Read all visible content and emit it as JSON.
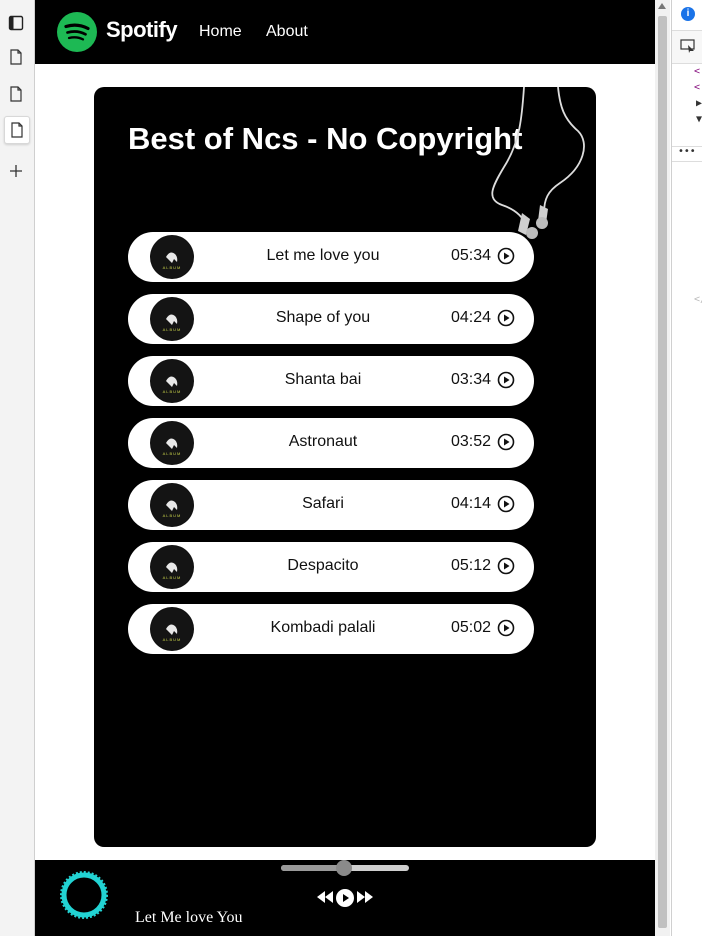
{
  "navbar": {
    "brand": "Spotify",
    "links": [
      "Home",
      "About"
    ]
  },
  "playlist": {
    "title": "Best of Ncs - No Copyright",
    "songs": [
      {
        "name": "Let me love you",
        "duration": "05:34"
      },
      {
        "name": "Shape of you",
        "duration": "04:24"
      },
      {
        "name": "Shanta bai",
        "duration": "03:34"
      },
      {
        "name": "Astronaut",
        "duration": "03:52"
      },
      {
        "name": "Safari",
        "duration": "04:14"
      },
      {
        "name": "Despacito",
        "duration": "05:12"
      },
      {
        "name": "Kombadi palali",
        "duration": "05:02"
      }
    ]
  },
  "player": {
    "now_playing": "Let Me love You",
    "progress": 0.49,
    "controls": [
      "previous-icon",
      "play-icon",
      "next-icon"
    ]
  },
  "colors": {
    "brand_green": "#1DB954",
    "background": "#000000",
    "visualizer_cyan": "#22d3d3"
  },
  "devtools": {
    "info_icon": "i"
  }
}
